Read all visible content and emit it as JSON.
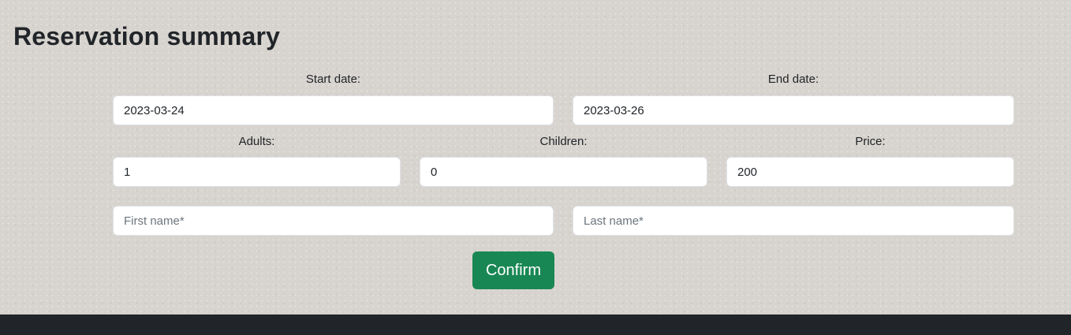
{
  "header": {
    "title": "Reservation summary"
  },
  "form": {
    "start_date": {
      "label": "Start date:",
      "value": "2023-03-24"
    },
    "end_date": {
      "label": "End date:",
      "value": "2023-03-26"
    },
    "adults": {
      "label": "Adults:",
      "value": "1"
    },
    "children": {
      "label": "Children:",
      "value": "0"
    },
    "price": {
      "label": "Price:",
      "value": "200"
    },
    "first_name": {
      "placeholder": "First name*",
      "value": ""
    },
    "last_name": {
      "placeholder": "Last name*",
      "value": ""
    },
    "confirm_label": "Confirm"
  },
  "colors": {
    "page_background": "#d7d3ce",
    "confirm_button": "#198754",
    "footer": "#212529"
  }
}
